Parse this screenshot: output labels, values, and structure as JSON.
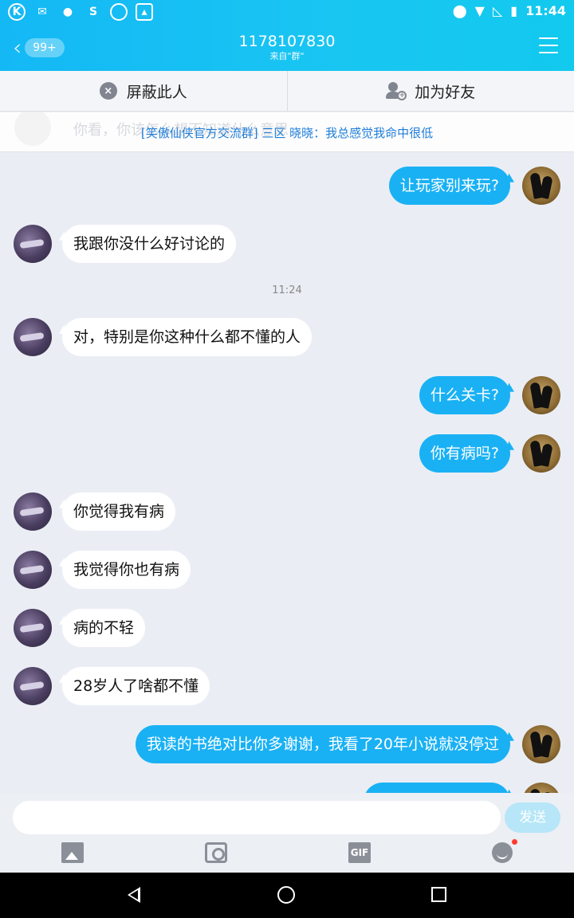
{
  "status_bar": {
    "time": "11:44",
    "left_icons": [
      "k-icon",
      "mail-icon",
      "wechat-icon",
      "weibo-icon",
      "loading-icon",
      "gallery-icon"
    ],
    "right_icons": [
      "location-icon",
      "wifi-icon",
      "no-signal-icon",
      "battery-icon"
    ]
  },
  "header": {
    "back_badge": "99+",
    "title": "1178107830",
    "subtitle": "来自\"群\""
  },
  "actions": {
    "block_label": "屏蔽此人",
    "add_friend_label": "加为好友"
  },
  "notice": {
    "ghost_text": "你看，你该怎么想不知道什么意思",
    "text": "[笑傲仙侠官方交流群] 三区  晓晓：我总感觉我命中很低"
  },
  "messages": [
    {
      "side": "self",
      "text": "让玩家别来玩?"
    },
    {
      "side": "other",
      "text": "我跟你没什么好讨论的"
    },
    {
      "side": "time",
      "text": "11:24"
    },
    {
      "side": "other",
      "text": "对，特别是你这种什么都不懂的人"
    },
    {
      "side": "self",
      "text": "什么关卡?"
    },
    {
      "side": "self",
      "text": "你有病吗?"
    },
    {
      "side": "other",
      "text": "你觉得我有病"
    },
    {
      "side": "other",
      "text": "我觉得你也有病"
    },
    {
      "side": "other",
      "text": "病的不轻"
    },
    {
      "side": "other",
      "text": "28岁人了啥都不懂"
    },
    {
      "side": "self",
      "text": "我读的书绝对比你多谢谢，我看了20年小说就没停过"
    }
  ],
  "input": {
    "placeholder": "",
    "send_label": "发送",
    "gif_label": "GIF"
  },
  "colors": {
    "header_gradient_start": "#14b8f5",
    "self_bubble": "#1ab1f4",
    "other_bubble": "#ffffff",
    "chat_background": "#eaeef4",
    "notice_text": "#1f7ed9"
  }
}
